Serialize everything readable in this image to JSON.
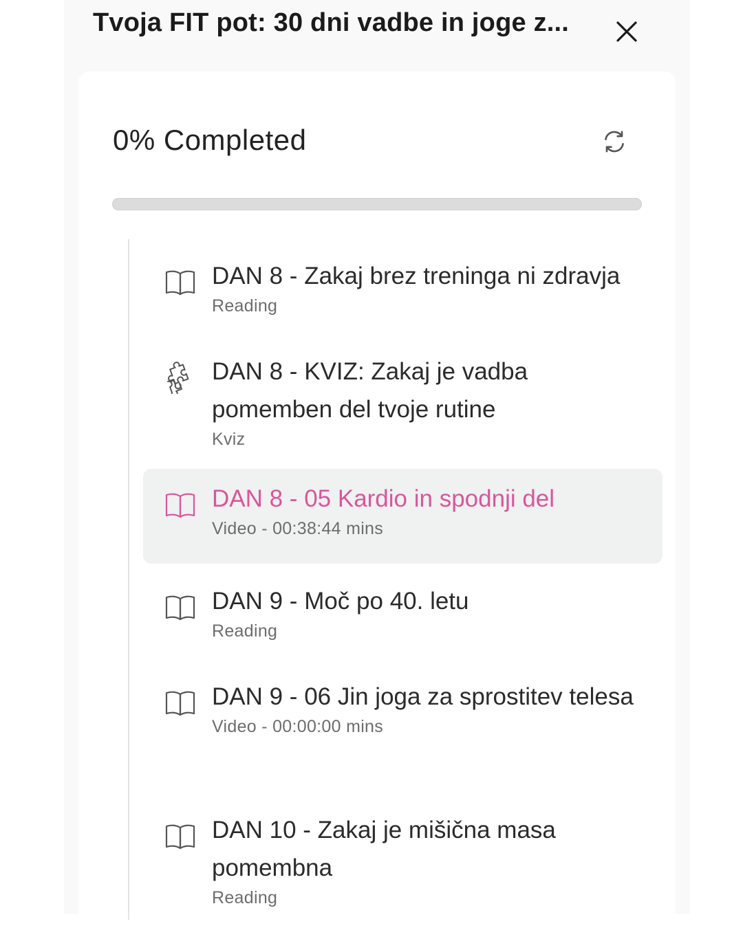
{
  "header": {
    "title": "Tvoja FIT pot: 30 dni vadbe in joge z..."
  },
  "progress": {
    "label": "0% Completed",
    "fraction": 0
  },
  "colors": {
    "accent": "#d8579a",
    "text": "#2b2b2b",
    "muted": "#6d6d6d",
    "active_bg": "#f0f1f1"
  },
  "lessons": [
    {
      "title": "DAN 8 - Zakaj brez treninga ni zdravja",
      "meta": "Reading",
      "icon": "book-icon"
    },
    {
      "title": "DAN 8 - KVIZ: Zakaj je vadba pomemben del tvoje rutine",
      "meta": "Kviz",
      "icon": "puzzle-icon"
    },
    {
      "title": "DAN 8 - 05 Kardio in spodnji del",
      "meta": "Video - 00:38:44 mins",
      "icon": "book-icon",
      "active": true
    },
    {
      "title": "DAN 9 - Moč po 40. letu",
      "meta": "Reading",
      "icon": "book-icon"
    },
    {
      "title": "DAN 9 - 06 Jin joga za sprostitev telesa",
      "meta": "Video - 00:00:00 mins",
      "icon": "book-icon"
    },
    {
      "title": "DAN 10 - Zakaj je mišična masa pomembna",
      "meta": "Reading",
      "icon": "book-icon"
    }
  ]
}
